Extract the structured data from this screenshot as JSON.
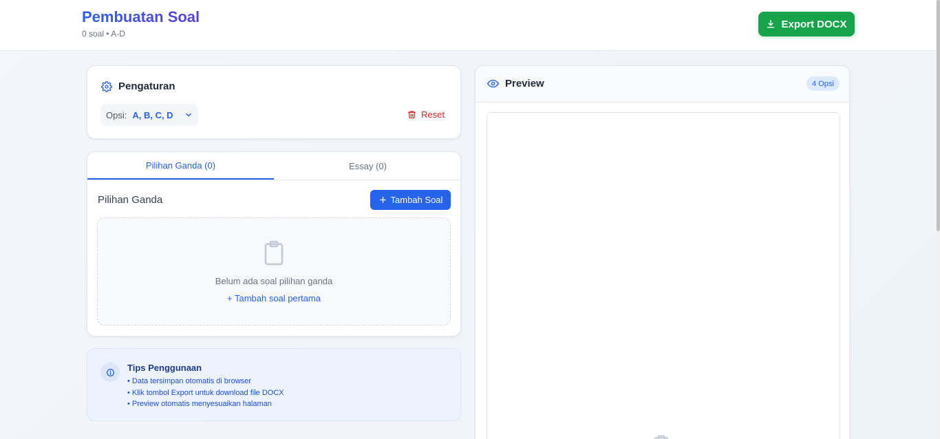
{
  "header": {
    "title": "Pembuatan Soal",
    "subtitle": "0 soal • A-D",
    "export_label": "Export DOCX"
  },
  "settings": {
    "title": "Pengaturan",
    "opsi_label": "Opsi:",
    "opsi_value": "A, B, C, D",
    "reset_label": "Reset"
  },
  "tabs": [
    {
      "label": "Pilihan Ganda (0)",
      "active": true
    },
    {
      "label": "Essay (0)",
      "active": false
    }
  ],
  "panel": {
    "section_title": "Pilihan Ganda",
    "add_label": "Tambah Soal",
    "empty_text": "Belum ada soal pilihan ganda",
    "empty_link": "+ Tambah soal pertama"
  },
  "tips": {
    "title": "Tips Penggunaan",
    "items": [
      "• Data tersimpan otomatis di browser",
      "• Klik tombol Export untuk download file DOCX",
      "• Preview otomatis menyesuaikan halaman"
    ]
  },
  "preview": {
    "title": "Preview",
    "badge": "4 Opsi"
  },
  "colors": {
    "accent": "#2563eb",
    "export": "#16a34a",
    "danger": "#dc2626"
  }
}
